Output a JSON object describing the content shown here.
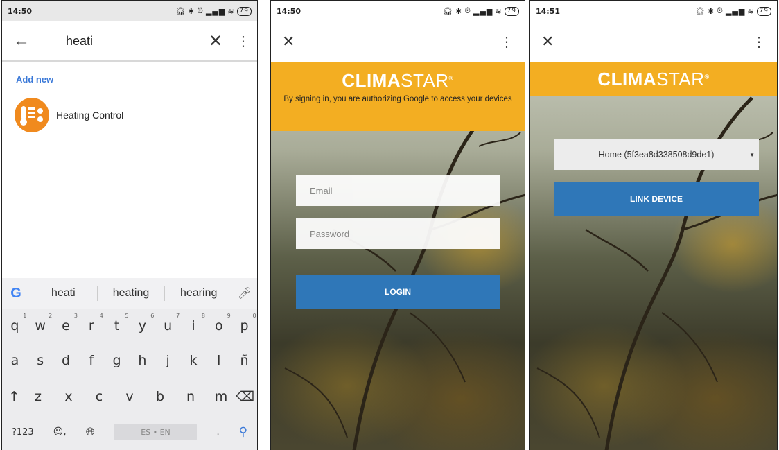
{
  "screen1": {
    "status": {
      "time": "14:50",
      "battery": "79"
    },
    "search": {
      "query": "heati",
      "back_icon": "arrow-left-icon",
      "clear_icon": "close-icon"
    },
    "add_new": "Add new",
    "result": {
      "label": "Heating Control",
      "icon": "heating-control-app-icon"
    },
    "keyboard": {
      "suggestions": [
        "heati",
        "heating",
        "hearing"
      ],
      "row1": [
        [
          "q",
          "1"
        ],
        [
          "w",
          "2"
        ],
        [
          "e",
          "3"
        ],
        [
          "r",
          "4"
        ],
        [
          "t",
          "5"
        ],
        [
          "y",
          "6"
        ],
        [
          "u",
          "7"
        ],
        [
          "i",
          "8"
        ],
        [
          "o",
          "9"
        ],
        [
          "p",
          "0"
        ]
      ],
      "row2": [
        "a",
        "s",
        "d",
        "f",
        "g",
        "h",
        "j",
        "k",
        "l",
        "ñ"
      ],
      "row3": [
        "z",
        "x",
        "c",
        "v",
        "b",
        "n",
        "m"
      ],
      "symbols_key": "?123",
      "space_label": "ES • EN",
      "period": ".",
      "comma": ","
    }
  },
  "screen2": {
    "status": {
      "time": "14:50",
      "battery": "79"
    },
    "logo": {
      "bold": "CLIMA",
      "thin": "STAR"
    },
    "auth_text": "By signing in, you are authorizing Google to access your devices",
    "email_placeholder": "Email",
    "password_placeholder": "Password",
    "login_label": "LOGIN"
  },
  "screen3": {
    "status": {
      "time": "14:51",
      "battery": "79"
    },
    "logo": {
      "bold": "CLIMA",
      "thin": "STAR"
    },
    "home_select": "Home (5f3ea8d338508d9de1)",
    "link_label": "LINK DEVICE"
  },
  "colors": {
    "accent": "#f3ae22",
    "button": "#2f77b8",
    "link": "#3b79d8"
  }
}
